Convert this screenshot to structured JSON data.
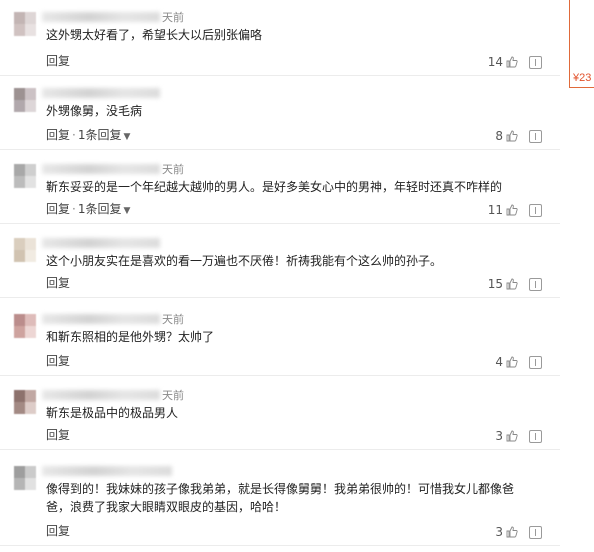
{
  "comments": [
    {
      "time": "天前",
      "text": "这外甥太好看了，希望长大以后别张偏咯",
      "reply_label": "回复",
      "more_label": "",
      "likes": "14",
      "avatar_colors": [
        "#b9a9a8",
        "#d9cfcf",
        "#c8b8b7",
        "#e4dcdc"
      ]
    },
    {
      "time": "",
      "text": "外甥像舅，没毛病",
      "reply_label": "回复",
      "more_label": "1条回复",
      "likes": "8",
      "avatar_colors": [
        "#8c7f80",
        "#c4b8bb",
        "#a49a9e",
        "#d8d0d2"
      ]
    },
    {
      "time": "天前",
      "text": "靳东妥妥的是一个年纪越大越帅的男人。是好多美女心中的男神，年轻时还真不咋样的",
      "reply_label": "回复",
      "more_label": "1条回复",
      "likes": "11",
      "avatar_colors": [
        "#9a9a9a",
        "#c7c7c7",
        "#b1b1b1",
        "#dedede"
      ]
    },
    {
      "time": "",
      "text": "这个小朋友实在是喜欢的看一万遍也不厌倦！祈祷我能有个这么帅的孙子。",
      "reply_label": "回复",
      "more_label": "",
      "likes": "15",
      "avatar_colors": [
        "#d4c6b3",
        "#e8dfd2",
        "#c9b9a4",
        "#efe8de"
      ]
    },
    {
      "time": "天前",
      "text": "和靳东照相的是他外甥？太帅了",
      "reply_label": "回复",
      "more_label": "",
      "likes": "4",
      "avatar_colors": [
        "#b07a78",
        "#d9b1ae",
        "#c6938f",
        "#ead0cd"
      ]
    },
    {
      "time": "天前",
      "text": "靳东是极品中的极品男人",
      "reply_label": "回复",
      "more_label": "",
      "likes": "3",
      "avatar_colors": [
        "#7a5a54",
        "#b79a93",
        "#94766f",
        "#d8c4bf"
      ]
    },
    {
      "time": "",
      "text": "像得到的！我妹妹的孩子像我弟弟，就是长得像舅舅！我弟弟很帅的！可惜我女儿都像爸爸，浪费了我家大眼睛双眼皮的基因，哈哈！",
      "reply_label": "回复",
      "more_label": "",
      "likes": "3",
      "avatar_colors": [
        "#8e8e8e",
        "#c2c2c2",
        "#a9a9a9",
        "#dcdcdc"
      ]
    }
  ],
  "side": {
    "price": "¥23"
  },
  "icons": {
    "like": "thumbs-up-icon",
    "report": "report-icon",
    "expand": "chevron-down-icon"
  }
}
